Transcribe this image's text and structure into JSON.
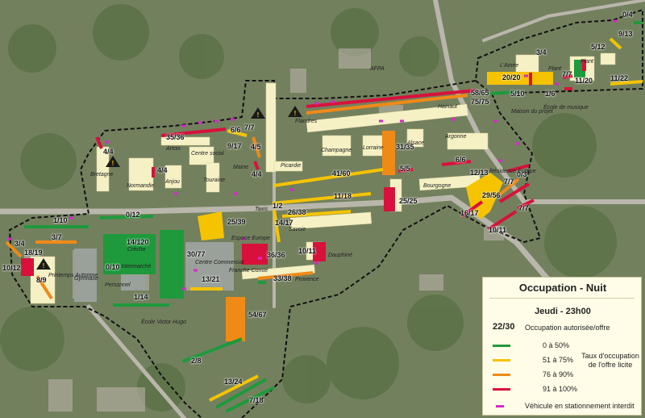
{
  "legend": {
    "title": "Occupation - Nuit",
    "subtitle": "Jeudi - 23h00",
    "example_ratio": "22/30",
    "example_label": "Occupation autorisée/offre",
    "classes": [
      {
        "label": "0 à 50%",
        "color": "#1e9a3c"
      },
      {
        "label": "51 à 75%",
        "color": "#f5c300"
      },
      {
        "label": "76 à 90%",
        "color": "#ef8a17"
      },
      {
        "label": "91 à 100%",
        "color": "#d8113c"
      }
    ],
    "taux_label": "Taux d'occupation de l'offre licite",
    "interdit_label": "Véhicule en stationnement interdit",
    "interdit_color": "#d629c9"
  },
  "ratios": [
    "0/4",
    "9/13",
    "5/12",
    "3/4",
    "7/7",
    "20/20",
    "11/20",
    "11/22",
    "5/10",
    "1/6",
    "58/65",
    "75/75",
    "35/36",
    "6/6",
    "7/7",
    "9/17",
    "4/5",
    "4/4",
    "4/4",
    "4/4",
    "41/60",
    "5/5",
    "6/6",
    "31/35",
    "12/13",
    "0/3",
    "7/7",
    "29/56",
    "16/17",
    "7/7",
    "10/11",
    "11/18",
    "1/2",
    "26/38",
    "25/25",
    "1/10",
    "0/12",
    "3/7",
    "3/4",
    "18/19",
    "10/12",
    "8/9",
    "14/120",
    "0/10",
    "30/77",
    "25/39",
    "14/17",
    "36/36",
    "10/11",
    "13/21",
    "33/38",
    "1/14",
    "54/67",
    "2/8",
    "13/24",
    "7/18"
  ],
  "places": [
    "AFPA",
    "Flandres",
    "Hainaut",
    "Picardie",
    "Champagne",
    "Lorraine",
    "Alsace",
    "Argonne",
    "Artois",
    "Centre social",
    "Maine",
    "Bretagne",
    "Normandie",
    "Anjou",
    "Touraine",
    "Bourgogne",
    "Résidence Europe",
    "Savoie",
    "Espace Europe",
    "Dauphiné",
    "Provence",
    "Centre Commercial",
    "Franche Comté",
    "Intermarché",
    "Gymnase",
    "Personnel",
    "Printemps Automne",
    "École Victor Hugo",
    "Maison du projet",
    "École de musique",
    "L'Ainée",
    "Plant",
    "Plant",
    "Taxis",
    "Crèche"
  ]
}
